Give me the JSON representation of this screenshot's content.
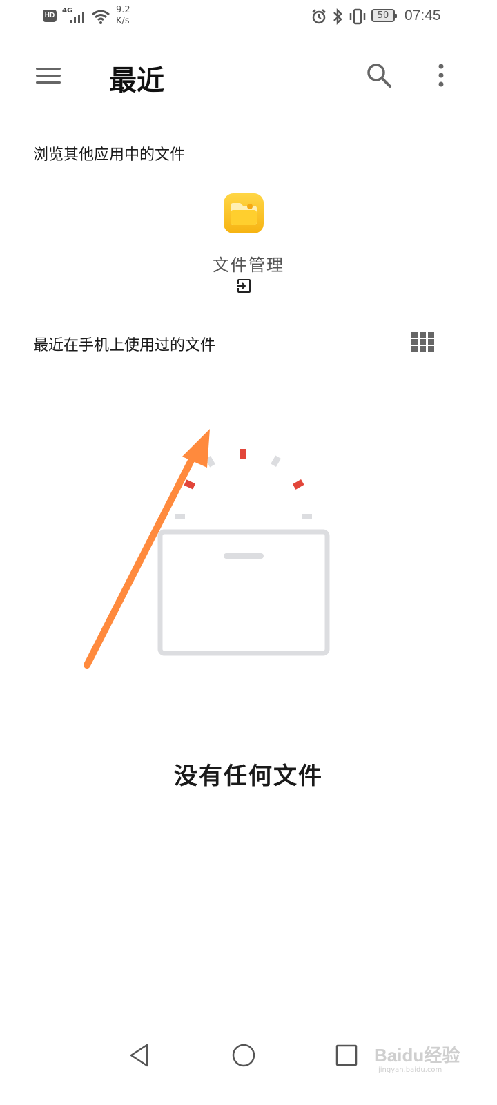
{
  "status_bar": {
    "hd": "HD",
    "network": "4G",
    "speed_value": "9.2",
    "speed_unit": "K/s",
    "battery": "50",
    "time": "07:45"
  },
  "app_bar": {
    "title": "最近",
    "menu_icon": "hamburger-menu-icon",
    "search_icon": "search-icon",
    "more_icon": "more-vertical-icon"
  },
  "browse_section": {
    "label": "浏览其他应用中的文件",
    "apps": [
      {
        "label": "文件管理",
        "icon": "file-manager-app-icon",
        "open_icon": "open-in-icon"
      }
    ]
  },
  "recent_section": {
    "label": "最近在手机上使用过的文件",
    "view_toggle_icon": "grid-view-icon"
  },
  "empty_state": {
    "text": "没有任何文件",
    "illustration": "empty-folder-illustration"
  },
  "annotation": {
    "arrow_color": "#ff8a3d"
  },
  "nav_bar": {
    "back_icon": "back-triangle-icon",
    "home_icon": "home-circle-icon",
    "recents_icon": "recents-square-icon"
  },
  "watermark": {
    "text": "Baidu经验",
    "sub": "jingyan.baidu.com"
  },
  "colors": {
    "folder_yellow": "#f9c51c",
    "illustration_gray": "#dcdde0",
    "illustration_red": "#e2463a"
  }
}
